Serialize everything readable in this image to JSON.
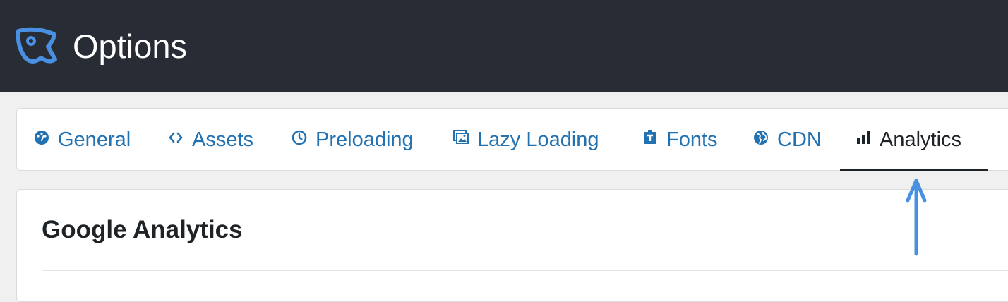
{
  "header": {
    "title": "Options",
    "logo_icon": "perfmatters-logo-icon",
    "background": "#282c35"
  },
  "tabs": [
    {
      "label": "General",
      "icon": "dashboard-gauge-icon",
      "active": false
    },
    {
      "label": "Assets",
      "icon": "code-brackets-icon",
      "active": false
    },
    {
      "label": "Preloading",
      "icon": "clock-icon",
      "active": false
    },
    {
      "label": "Lazy Loading",
      "icon": "images-icon",
      "active": false
    },
    {
      "label": "Fonts",
      "icon": "font-icon",
      "active": false
    },
    {
      "label": "CDN",
      "icon": "globe-icon",
      "active": false
    },
    {
      "label": "Analytics",
      "icon": "bar-chart-icon",
      "active": true
    }
  ],
  "section": {
    "title": "Google Analytics"
  },
  "colors": {
    "link": "#2271b1",
    "active_tab": "#1d2327",
    "annotation_arrow": "#4a90e2"
  }
}
